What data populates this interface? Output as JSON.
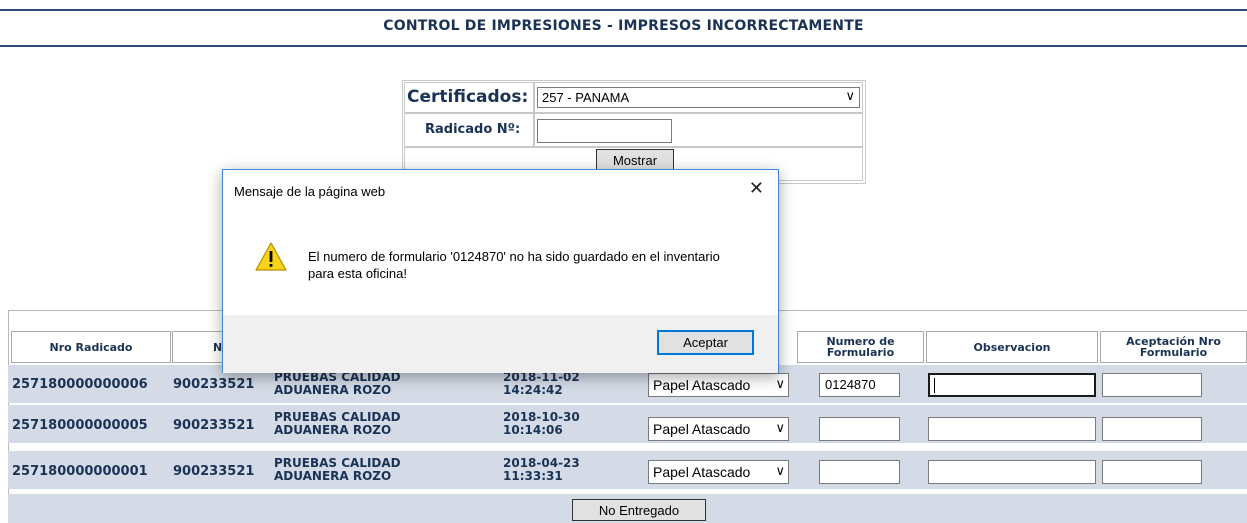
{
  "page": {
    "title": "CONTROL DE IMPRESIONES - IMPRESOS INCORRECTAMENTE"
  },
  "search_form": {
    "certificados_label": "Certificados:",
    "certificados_value": "257 - PANAMA",
    "radicado_label": "Radicado Nº:",
    "radicado_value": "",
    "mostrar_button": "Mostrar"
  },
  "table": {
    "headers": [
      "Nro Radicado",
      "N",
      "Numero de Formulario",
      "Observacion",
      "Aceptación Nro Formulario"
    ],
    "rows": [
      {
        "radicado": "257180000000006",
        "nit": "900233521",
        "name_line1": "PRUEBAS CALIDAD",
        "name_line2": "ADUANERA ROZO",
        "date": "2018-11-02",
        "time": "14:24:42",
        "motivo": "Papel Atascado",
        "formulario": "0124870",
        "observacion": "",
        "aceptacion": ""
      },
      {
        "radicado": "257180000000005",
        "nit": "900233521",
        "name_line1": "PRUEBAS CALIDAD",
        "name_line2": "ADUANERA ROZO",
        "date": "2018-10-30",
        "time": "10:14:06",
        "motivo": "Papel Atascado",
        "formulario": "",
        "observacion": "",
        "aceptacion": ""
      },
      {
        "radicado": "257180000000001",
        "nit": "900233521",
        "name_line1": "PRUEBAS CALIDAD",
        "name_line2": "ADUANERA ROZO",
        "date": "2018-04-23",
        "time": "11:33:31",
        "motivo": "Papel Atascado",
        "formulario": "",
        "observacion": "",
        "aceptacion": ""
      }
    ],
    "no_entregado_button": "No Entregado"
  },
  "dialog": {
    "title": "Mensaje de la página web",
    "message": "El numero de formulario '0124870' no ha sido guardado en el inventario para esta oficina!",
    "accept_button": "Aceptar",
    "icon": "warning-icon",
    "icon_color": "#f7d31a"
  },
  "colors": {
    "heading": "#1a3355",
    "row_background": "#d4dbe7",
    "dialog_border": "#3b8ad9"
  }
}
